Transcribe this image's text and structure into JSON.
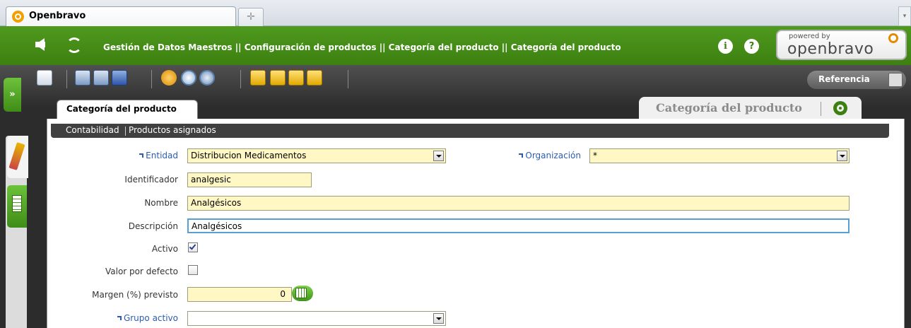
{
  "browser": {
    "tab_title": "Openbravo",
    "new_tab_glyph": "✛",
    "scroll_glyph": "▾"
  },
  "header": {
    "breadcrumb": "Gestión de Datos Maestros || Configuración de productos || Categoría del producto  || Categoría del producto",
    "info_glyph": "i",
    "help_glyph": "?",
    "logo_powered": "powered by",
    "logo_name": "openbravo",
    "accent_color": "#3d8011"
  },
  "side": {
    "toggle_glyph": "»"
  },
  "toolbar": {
    "icons": [
      "new-record-icon",
      "copy-record-icon",
      "paste-record-icon",
      "save-icon",
      "undo-icon",
      "search-icon",
      "advanced-search-icon",
      "first-record-icon",
      "previous-record-icon",
      "next-record-icon",
      "last-record-icon"
    ],
    "reference_label": "Referencia"
  },
  "window": {
    "tab_label": "Categoría del producto",
    "title": "Categoría del producto",
    "subtabs": [
      "Contabilidad",
      "Productos asignados"
    ]
  },
  "form": {
    "entidad": {
      "label": "Entidad",
      "value": "Distribucion Medicamentos"
    },
    "organizacion": {
      "label": "Organización",
      "value": "*"
    },
    "identificador": {
      "label": "Identificador",
      "value": "analgesic"
    },
    "nombre": {
      "label": "Nombre",
      "value": "Analgésicos"
    },
    "descripcion": {
      "label": "Descripción",
      "value": "Analgésicos"
    },
    "activo": {
      "label": "Activo",
      "checked": true
    },
    "valor_defecto": {
      "label": "Valor por defecto",
      "checked": false
    },
    "margen": {
      "label": "Margen (%) previsto",
      "value": "0"
    },
    "grupo_activo": {
      "label": "Grupo activo",
      "value": ""
    }
  }
}
